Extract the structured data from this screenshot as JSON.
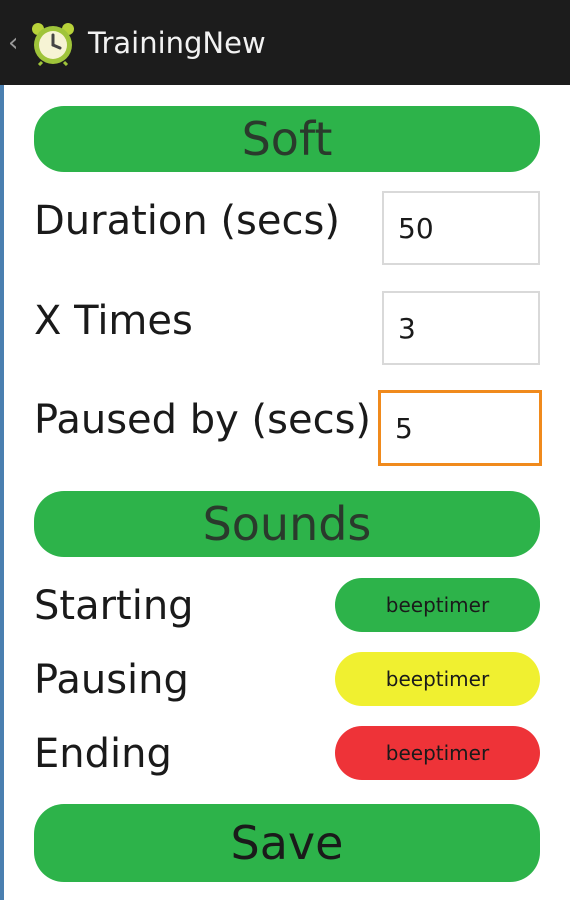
{
  "app": {
    "title": "TrainingNew",
    "icon": "alarm-clock-icon"
  },
  "colors": {
    "green": "#2db34a",
    "yellow": "#f0f030",
    "red": "#ee3338",
    "focus": "#f08a1c",
    "actionbar": "#1c1c1c"
  },
  "soft": {
    "header": "Soft",
    "duration_label": "Duration (secs)",
    "duration_value": "50",
    "times_label": "X Times",
    "times_value": "3",
    "paused_label": "Paused by (secs)",
    "paused_value": "5"
  },
  "sounds": {
    "header": "Sounds",
    "starting_label": "Starting",
    "starting_value": "beeptimer",
    "pausing_label": "Pausing",
    "pausing_value": "beeptimer",
    "ending_label": "Ending",
    "ending_value": "beeptimer"
  },
  "save_label": "Save"
}
